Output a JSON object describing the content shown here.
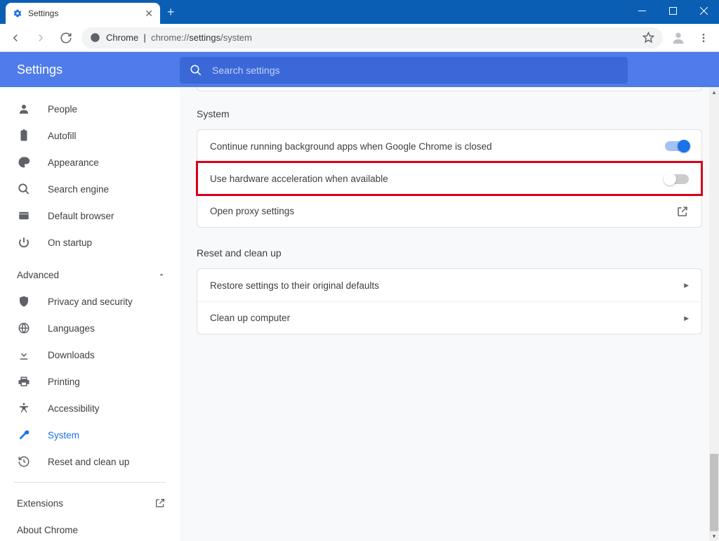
{
  "window": {
    "tab_title": "Settings",
    "url_host": "Chrome",
    "url_path_prefix": "chrome://",
    "url_path_bold": "settings",
    "url_path_rest": "/system"
  },
  "header": {
    "title": "Settings",
    "search_placeholder": "Search settings"
  },
  "sidebar": {
    "basic": [
      {
        "label": "People"
      },
      {
        "label": "Autofill"
      },
      {
        "label": "Appearance"
      },
      {
        "label": "Search engine"
      },
      {
        "label": "Default browser"
      },
      {
        "label": "On startup"
      }
    ],
    "advanced_label": "Advanced",
    "advanced": [
      {
        "label": "Privacy and security"
      },
      {
        "label": "Languages"
      },
      {
        "label": "Downloads"
      },
      {
        "label": "Printing"
      },
      {
        "label": "Accessibility"
      },
      {
        "label": "System"
      },
      {
        "label": "Reset and clean up"
      }
    ],
    "extensions": "Extensions",
    "about": "About Chrome"
  },
  "page": {
    "system_title": "System",
    "system_rows": [
      {
        "label": "Continue running background apps when Google Chrome is closed"
      },
      {
        "label": "Use hardware acceleration when available"
      },
      {
        "label": "Open proxy settings"
      }
    ],
    "reset_title": "Reset and clean up",
    "reset_rows": [
      {
        "label": "Restore settings to their original defaults"
      },
      {
        "label": "Clean up computer"
      }
    ]
  }
}
